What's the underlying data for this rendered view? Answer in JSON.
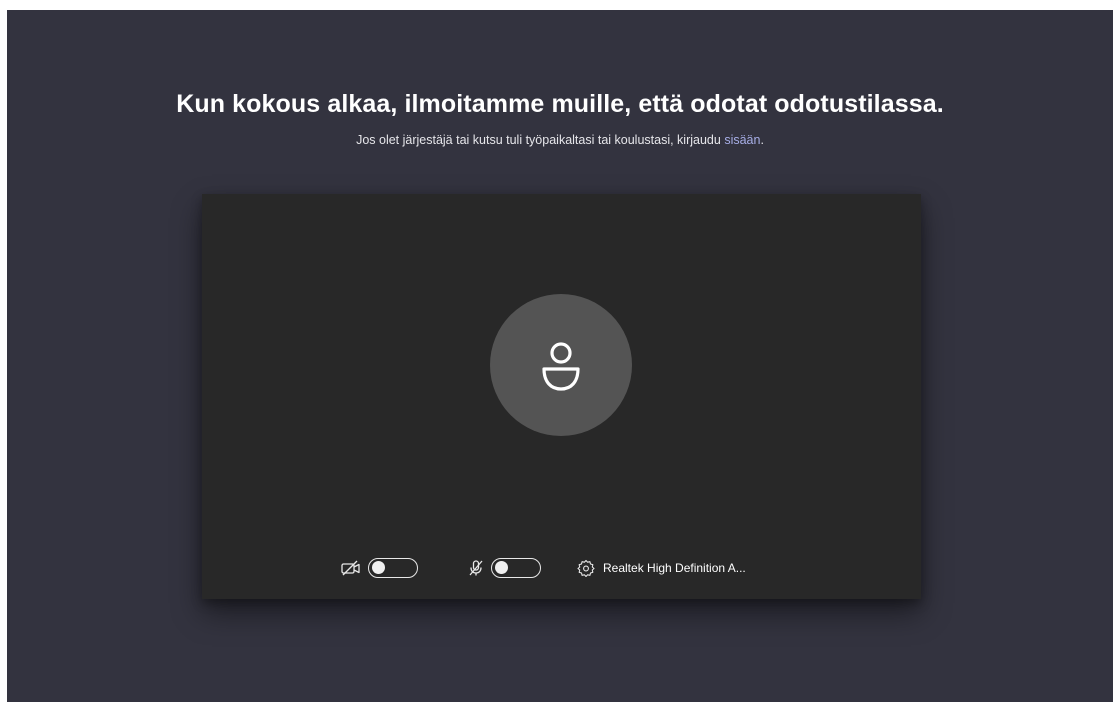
{
  "prejoin": {
    "headline": "Kun kokous alkaa, ilmoitamme muille, että odotat odotustilassa.",
    "subline_prefix": "Jos olet järjestäjä tai kutsu tuli työpaikaltasi tai koulustasi, kirjaudu ",
    "subline_link": "sisään",
    "subline_suffix": "."
  },
  "controls": {
    "camera": {
      "icon": "camera-off-icon",
      "enabled": false
    },
    "microphone": {
      "icon": "mic-off-icon",
      "enabled": false
    },
    "device_settings": {
      "icon": "gear-icon",
      "label": "Realtek High Definition A..."
    }
  },
  "colors": {
    "background": "#33333f",
    "preview": "#282828",
    "avatar": "#545454",
    "link": "#a7aee6"
  }
}
